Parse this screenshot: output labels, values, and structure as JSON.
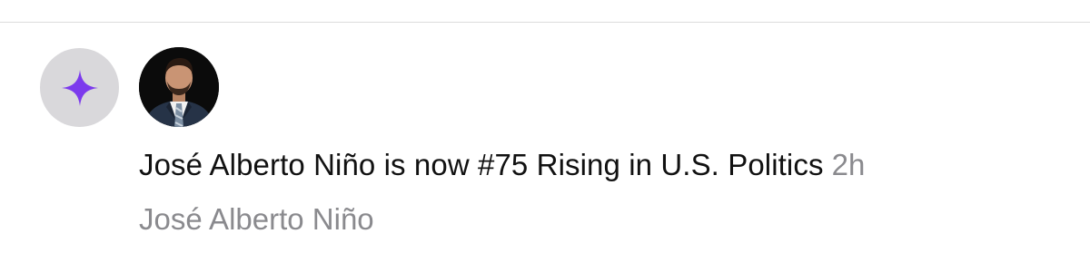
{
  "notification": {
    "icon": "sparkle-icon",
    "accent_color": "#7c3aed",
    "badge_color": "#d9d8db",
    "avatar_label": "José Alberto Niño",
    "headline": "José Alberto Niño is now #75 Rising in U.S. Politics",
    "timestamp": "2h",
    "subtext": "José Alberto Niño"
  }
}
